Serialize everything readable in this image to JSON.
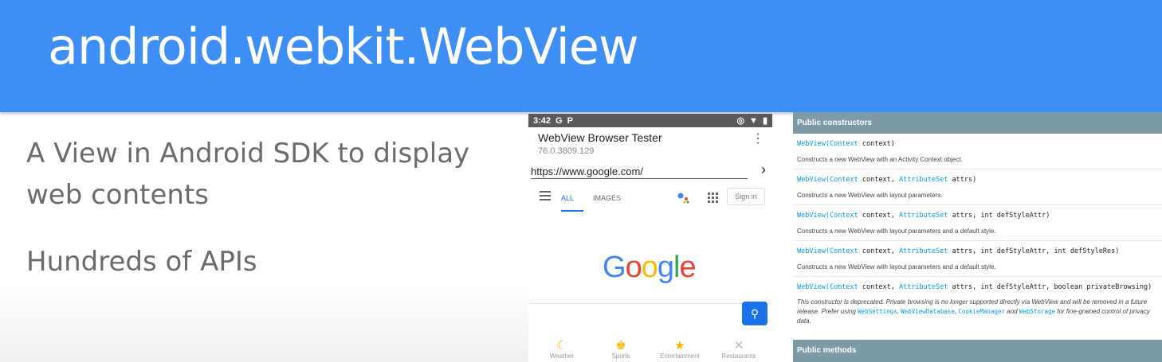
{
  "slide": {
    "title": "android.webkit.WebView",
    "bullet1": "A View in Android SDK to display web contents",
    "bullet2": "Hundreds of APIs",
    "accent_color": "#3d8ff5"
  },
  "phone": {
    "status_time": "3:42",
    "status_icons": [
      "google-icon",
      "p-icon",
      "vibrate-icon",
      "wifi-icon",
      "battery-icon"
    ],
    "app_title": "WebView Browser Tester",
    "app_version": "76.0.3809.129",
    "url": "https://www.google.com/",
    "tabs": [
      "ALL",
      "IMAGES"
    ],
    "signin": "Sign in",
    "logo": [
      "G",
      "o",
      "o",
      "g",
      "l",
      "e"
    ],
    "logo_colors": [
      "#4285F4",
      "#EA4335",
      "#FBBC05",
      "#4285F4",
      "#34A853",
      "#EA4335"
    ],
    "quick_links": [
      {
        "label": "Weather",
        "icon": "weather-icon"
      },
      {
        "label": "Sports",
        "icon": "trophy-icon"
      },
      {
        "label": "Entertainment",
        "icon": "star-icon"
      },
      {
        "label": "Restaurants",
        "icon": "restaurant-icon"
      }
    ]
  },
  "docs": {
    "constructors_header": "Public constructors",
    "methods_header": "Public methods",
    "constructors": [
      {
        "sig_pre": "WebView(",
        "sig_type": "Context",
        "sig_rest": " context)",
        "desc": "Constructs a new WebView with an Activity Context object."
      },
      {
        "sig_pre": "WebView(",
        "sig_type": "Context",
        "sig_mid": " context, ",
        "sig_type2": "AttributeSet",
        "sig_rest": " attrs)",
        "desc": "Constructs a new WebView with layout parameters."
      },
      {
        "sig_pre": "WebView(",
        "sig_type": "Context",
        "sig_mid": " context, ",
        "sig_type2": "AttributeSet",
        "sig_rest": " attrs, int defStyleAttr)",
        "desc": "Constructs a new WebView with layout parameters and a default style."
      },
      {
        "sig_pre": "WebView(",
        "sig_type": "Context",
        "sig_mid": " context, ",
        "sig_type2": "AttributeSet",
        "sig_rest": " attrs, int defStyleAttr, int defStyleRes)",
        "desc": "Constructs a new WebView with layout parameters and a default style."
      },
      {
        "sig_pre": "WebView(",
        "sig_type": "Context",
        "sig_mid": " context, ",
        "sig_type2": "AttributeSet",
        "sig_rest": " attrs, int defStyleAttr, boolean privateBrowsing)",
        "desc": ""
      }
    ],
    "deprecated_text_1": "This constructor is deprecated. Private browsing is no longer supported directly via WebView and will be removed in a future release. Prefer using ",
    "deprecated_links": [
      "WebSettings",
      "WebViewDatabase",
      "CookieManager",
      "WebStorage"
    ],
    "deprecated_sep_1": ", ",
    "deprecated_sep_2": ", ",
    "deprecated_and": " and ",
    "deprecated_text_2": " for fine-grained control of privacy data."
  }
}
